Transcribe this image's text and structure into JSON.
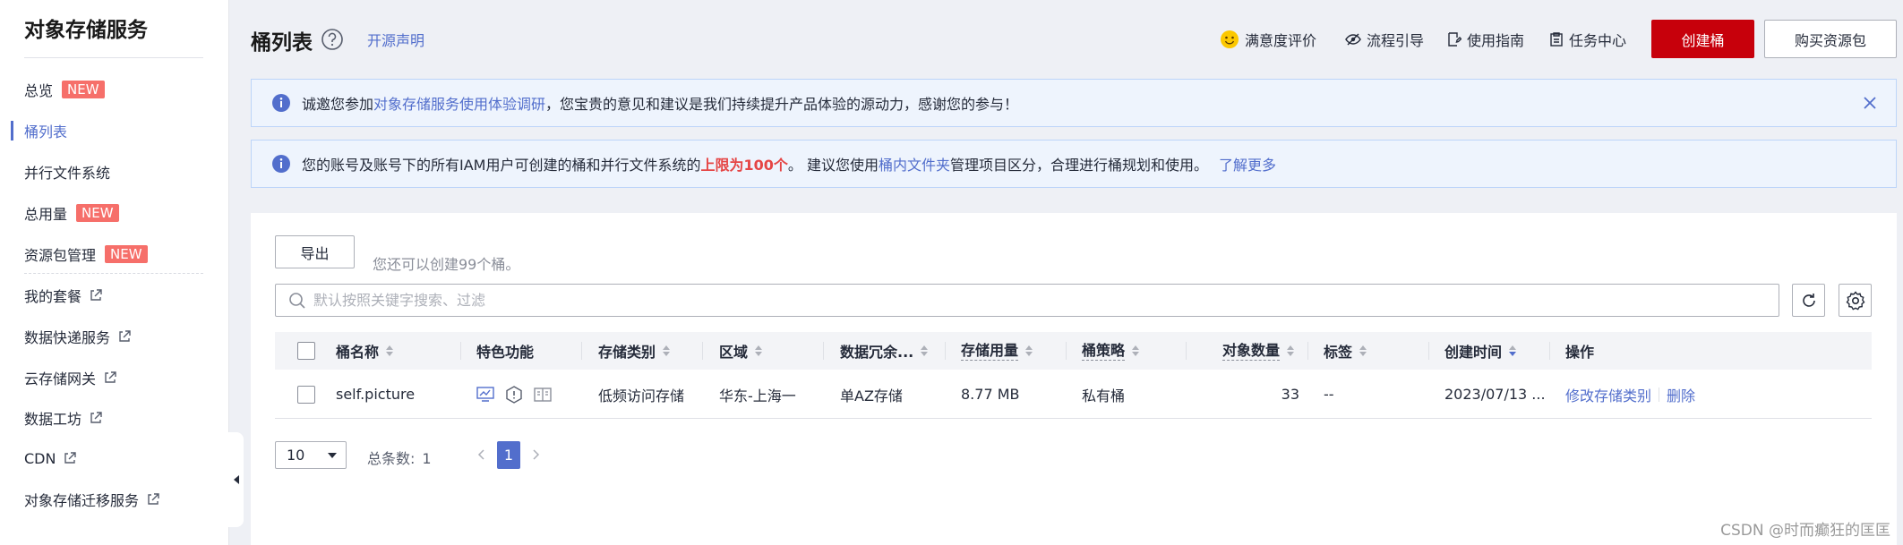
{
  "sidebar": {
    "title": "对象存储服务",
    "items": [
      {
        "label": "总览",
        "badge": "NEW"
      },
      {
        "label": "桶列表"
      },
      {
        "label": "并行文件系统"
      },
      {
        "label": "总用量",
        "badge": "NEW"
      },
      {
        "label": "资源包管理",
        "badge": "NEW"
      },
      {
        "label": "我的套餐"
      },
      {
        "label": "数据快递服务"
      },
      {
        "label": "云存储网关"
      },
      {
        "label": "数据工坊"
      },
      {
        "label": "CDN"
      },
      {
        "label": "对象存储迁移服务"
      }
    ],
    "active_item": "桶列表"
  },
  "header": {
    "title": "桶列表",
    "opensource_link": "开源声明",
    "links": [
      "满意度评价",
      "流程引导",
      "使用指南",
      "任务中心"
    ],
    "create_button": "创建桶",
    "buy_button": "购买资源包"
  },
  "notices": {
    "survey": {
      "prefix": "诚邀您参加",
      "link": "对象存储服务使用体验调研",
      "suffix": "，您宝贵的意见和建议是我们持续提升产品体验的源动力，感谢您的参与！"
    },
    "limit": {
      "prefix": "您的账号及账号下的所有IAM用户可创建的桶和并行文件系统的",
      "highlight": "上限为100个",
      "middle": "。 建议您使用",
      "link": "桶内文件夹",
      "suffix": "管理项目区分，合理进行桶规划和使用。",
      "more_link": "了解更多"
    }
  },
  "toolbar": {
    "export_button": "导出",
    "quota_hint": "您还可以创建99个桶。",
    "search_placeholder": "默认按照关键字搜索、过滤"
  },
  "table": {
    "columns": [
      "桶名称",
      "特色功能",
      "存储类别",
      "区域",
      "数据冗余...",
      "存储用量",
      "桶策略",
      "对象数量",
      "标签",
      "创建时间",
      "操作"
    ],
    "rows": [
      {
        "name": "self.picture",
        "feature_icons": [
          "monitor-icon",
          "shield-icon",
          "book-icon"
        ],
        "storage_class": "低频访问存储",
        "region": "华东-上海一",
        "redundancy": "单AZ存储",
        "usage": "8.77 MB",
        "policy": "私有桶",
        "object_count": "33",
        "tags": "--",
        "created": "2023/07/13 ...",
        "actions": [
          "修改存储类别",
          "删除"
        ]
      }
    ]
  },
  "pagination": {
    "page_size": "10",
    "total_label": "总条数:",
    "total": "1",
    "current_page": "1"
  },
  "watermark": "CSDN @时而癫狂的匡匡",
  "colors": {
    "accent": "#526ecc",
    "brand_red": "#c7000b",
    "badge_red": "#f66f6a"
  }
}
